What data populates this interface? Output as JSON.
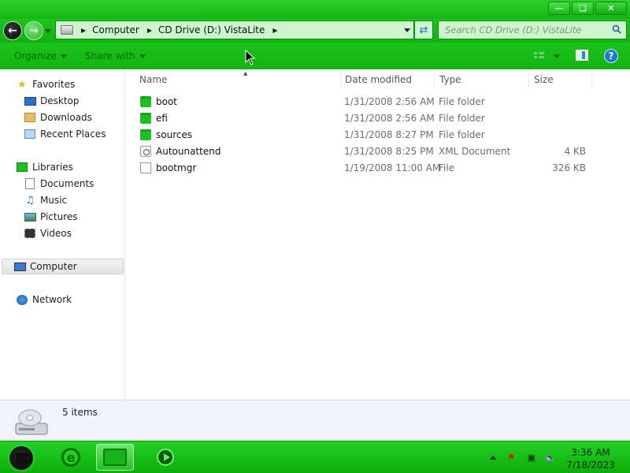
{
  "window": {
    "controls": [
      "minimize",
      "maximize",
      "close"
    ]
  },
  "navigation": {
    "breadcrumbs": [
      "Computer",
      "CD Drive (D:) VistaLite"
    ],
    "search_placeholder": "Search CD Drive (D:) VistaLite"
  },
  "toolbar": {
    "organize": "Organize",
    "share_with": "Share with"
  },
  "sidebar": {
    "favorites": {
      "label": "Favorites",
      "items": [
        "Desktop",
        "Downloads",
        "Recent Places"
      ]
    },
    "libraries": {
      "label": "Libraries",
      "items": [
        "Documents",
        "Music",
        "Pictures",
        "Videos"
      ]
    },
    "computer": "Computer",
    "network": "Network"
  },
  "columns": [
    "Name",
    "Date modified",
    "Type",
    "Size"
  ],
  "files": [
    {
      "name": "boot",
      "date": "1/31/2008 2:56 AM",
      "type": "File folder",
      "size": "",
      "icon": "folder-icon"
    },
    {
      "name": "efi",
      "date": "1/31/2008 2:56 AM",
      "type": "File folder",
      "size": "",
      "icon": "folder-icon"
    },
    {
      "name": "sources",
      "date": "1/31/2008 8:27 PM",
      "type": "File folder",
      "size": "",
      "icon": "folder-icon"
    },
    {
      "name": "Autounattend",
      "date": "1/31/2008 8:25 PM",
      "type": "XML Document",
      "size": "4 KB",
      "icon": "xml-document-icon"
    },
    {
      "name": "bootmgr",
      "date": "1/19/2008 11:00 AM",
      "type": "File",
      "size": "326 KB",
      "icon": "file-icon"
    }
  ],
  "details": {
    "item_count": "5 items"
  },
  "taskbar": {
    "time": "3:36 AM",
    "date": "7/18/2023"
  },
  "colors": {
    "theme_green": "#12b512",
    "address_bg": "#cdf5cd",
    "details_bg": "#f0f3fb"
  }
}
